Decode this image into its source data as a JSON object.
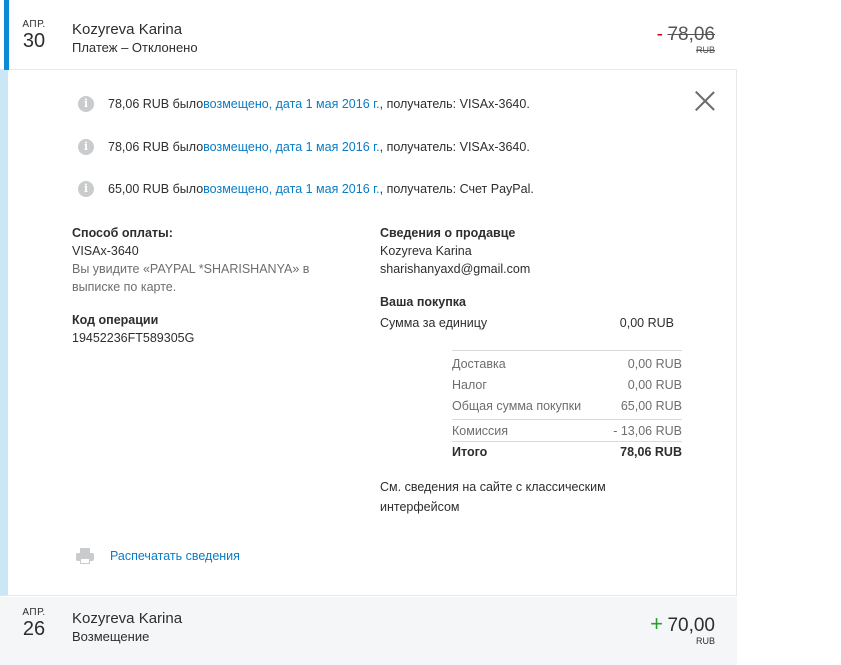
{
  "top_tx": {
    "month": "АПР.",
    "day": "30",
    "name": "Kozyreva Karina",
    "status": "Платеж – Отклонено",
    "sign": "-",
    "amount": "78,06",
    "currency": "RUB"
  },
  "notes": [
    {
      "prefix": "78,06 RUB было ",
      "link": "возмещено, дата 1 мая 2016 г.",
      "suffix": ", получатель: VISAx-3640."
    },
    {
      "prefix": "78,06 RUB было ",
      "link": "возмещено, дата 1 мая 2016 г.",
      "suffix": ", получатель: VISAx-3640."
    },
    {
      "prefix": "65,00 RUB было ",
      "link": "возмещено, дата 1 мая 2016 г.",
      "suffix": ", получатель: Счет PayPal."
    }
  ],
  "payment": {
    "label": "Способ оплаты:",
    "method": "VISAx-3640",
    "statement_line1": "Вы увидите «PAYPAL *SHARISHANYA» в",
    "statement_line2": "выписке по карте."
  },
  "operation": {
    "label": "Код операции",
    "code": "19452236FT589305G"
  },
  "seller": {
    "label": "Сведения о продавце",
    "name": "Kozyreva Karina",
    "email": "sharishanyaxd@gmail.com"
  },
  "purchase": {
    "label": "Ваша покупка",
    "unit_label": "Сумма за единицу",
    "unit_value": "0,00 RUB",
    "delivery_label": "Доставка",
    "delivery_value": "0,00 RUB",
    "tax_label": "Налог",
    "tax_value": "0,00 RUB",
    "total_purchase_label": "Общая сумма покупки",
    "total_purchase_value": "65,00 RUB",
    "fee_label": "Комиссия",
    "fee_value": "- 13,06 RUB",
    "total_label": "Итого",
    "total_value": "78,06 RUB"
  },
  "classic_link_line1": "См. сведения на сайте с классическим",
  "classic_link_line2": "интерфейсом",
  "print_label": "Распечатать сведения",
  "bottom_tx": {
    "month": "АПР.",
    "day": "26",
    "name": "Kozyreva Karina",
    "status": "Возмещение",
    "sign": "+",
    "amount": "70,00",
    "currency": "RUB"
  },
  "colors": {
    "accent": "#0a8bd7",
    "link": "#0a7cc4",
    "negative": "#d20000",
    "positive": "#2a9d30"
  }
}
